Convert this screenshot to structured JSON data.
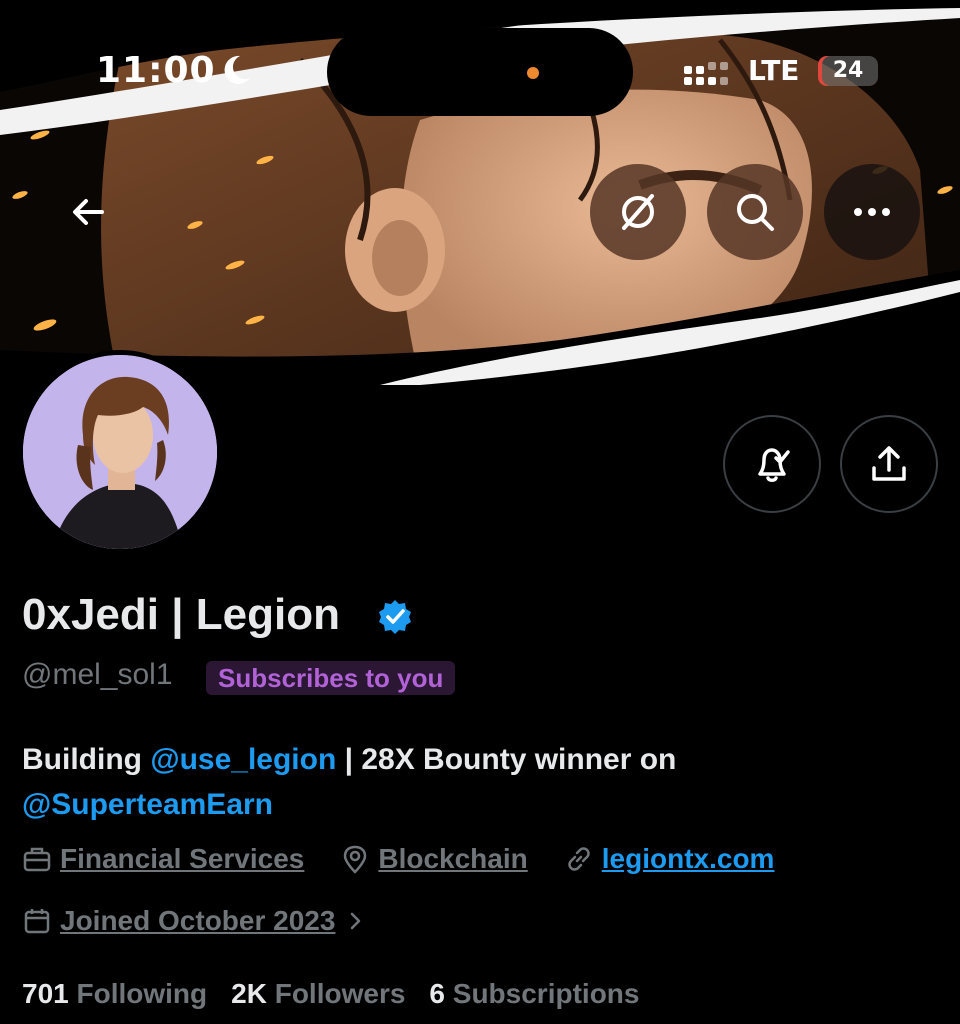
{
  "status_bar": {
    "time": "11:00",
    "network": "LTE",
    "battery": "24"
  },
  "profile": {
    "display_name": "0xJedi | Legion",
    "handle": "@mel_sol1",
    "subscribes_badge": "Subscribes to you",
    "bio": {
      "part1": "Building ",
      "mention1": "@use_legion",
      "part2": " | 28X Bounty winner on ",
      "mention2": "@SuperteamEarn"
    },
    "category": "Financial Services",
    "location": "Blockchain",
    "website": "legiontx.com",
    "joined": "Joined October 2023"
  },
  "stats": {
    "following_count": "701",
    "following_label": "Following",
    "followers_count": "2K",
    "followers_label": "Followers",
    "subscriptions_count": "6",
    "subscriptions_label": "Subscriptions"
  },
  "icons": {
    "back": "arrow-left-icon",
    "grok": "grok-icon",
    "search": "search-icon",
    "more": "more-icon",
    "notifications": "bell-check-icon",
    "share": "share-icon",
    "verified": "verified-badge-icon",
    "category": "briefcase-icon",
    "location": "location-pin-icon",
    "website": "link-icon",
    "joined": "calendar-icon"
  },
  "colors": {
    "accent": "#1d9bf0",
    "badge_text": "#b062d6",
    "badge_bg": "#2b1733",
    "muted": "#71767b"
  }
}
